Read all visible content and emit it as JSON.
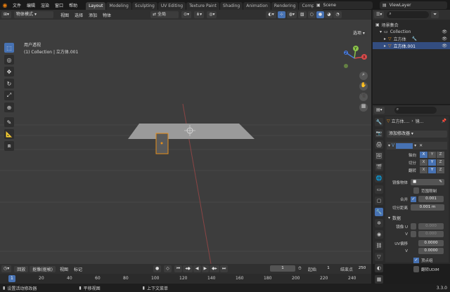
{
  "menu": [
    "文件",
    "编辑",
    "渲染",
    "窗口",
    "帮助"
  ],
  "workspaces": [
    "Layout",
    "Modeling",
    "Sculpting",
    "UV Editing",
    "Texture Paint",
    "Shading",
    "Animation",
    "Rendering",
    "Composi"
  ],
  "active_workspace": "Layout",
  "scene_name": "Scene",
  "view_layer": "ViewLayer",
  "viewport_header": {
    "mode": "物体模式",
    "menus": [
      "视图",
      "选择",
      "添加",
      "物体"
    ],
    "transform": "全局",
    "options_label": "选项"
  },
  "viewport": {
    "view_name": "用户透视",
    "collection_info": "(1) Collection | 立方体.001",
    "gizmo": {
      "x": "X",
      "y": "Y",
      "z": "Z"
    }
  },
  "outliner": {
    "root": "场景集合",
    "items": [
      {
        "name": "Collection",
        "level": 0
      },
      {
        "name": "立方体",
        "level": 1
      },
      {
        "name": "立方体.001",
        "level": 1,
        "selected": true
      }
    ]
  },
  "properties": {
    "object_name": "立方体....",
    "modifier_tab": "镜...",
    "add_modifier": "添加修改器",
    "axis_label": "轴向",
    "bisect_label": "切分",
    "flip_label": "翻转",
    "mirror_object_label": "镜像物体",
    "clipping_label": "范围限制",
    "merge_label": "合并",
    "merge_value": "0.001",
    "bisect_distance_label": "切分距离",
    "bisect_distance_value": "0.001 m",
    "data_label": "数据",
    "mirror_u_label": "镜像 U",
    "v_label": "V",
    "u_offset_label": "UV偏移",
    "u_offset_value": "0.0000",
    "v_offset_value": "0.0000",
    "vertex_groups_label": "顶点组",
    "flip_udim_label": "翻转UDIM",
    "axes": [
      "X",
      "Y",
      "Z"
    ],
    "u_value": "0.000",
    "v_value": "0.000"
  },
  "timeline": {
    "menus": [
      "回放",
      "抠像(抠帧)",
      "视图",
      "标记"
    ],
    "current_frame": "1",
    "start_label": "起始",
    "start": "1",
    "end_label": "结束点",
    "end": "250",
    "ticks": [
      "1",
      "20",
      "40",
      "60",
      "80",
      "100",
      "120",
      "140",
      "160",
      "180",
      "200",
      "220",
      "240"
    ]
  },
  "statusbar": {
    "left": "设置活动修改器",
    "mid": "平移视图",
    "right": "上下文菜单",
    "version": "3.3.0"
  }
}
